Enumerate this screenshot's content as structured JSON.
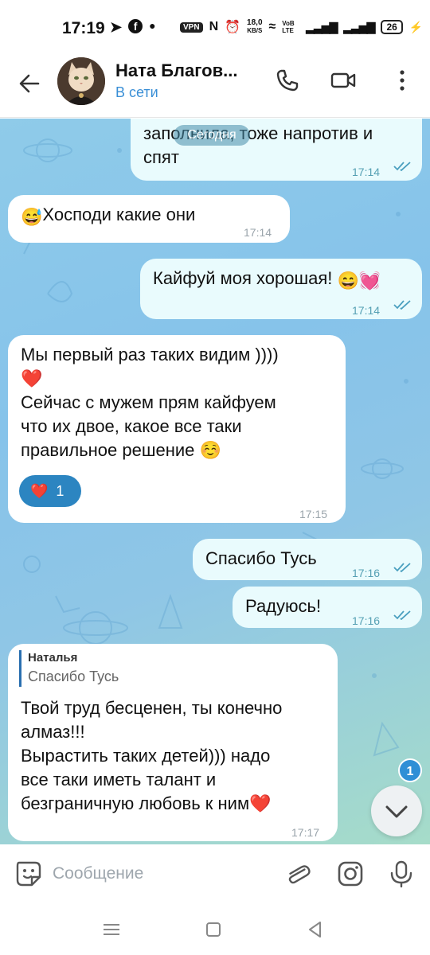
{
  "status_bar": {
    "time": "17:19",
    "vpn_label": "VPN",
    "speed_value": "18,0",
    "speed_unit": "KB/S",
    "volte": "VoB LTE",
    "battery": "26"
  },
  "header": {
    "contact_name": "Ната Благов...",
    "contact_status": "В сети"
  },
  "chat": {
    "date_chip": "Сегодня",
    "messages": [
      {
        "direction": "out",
        "text_lines": [
          "заполнила, тоже напротив и",
          "спят"
        ],
        "time": "17:14",
        "read": true
      },
      {
        "direction": "in",
        "emoji": "😅",
        "text": "Хосподи какие они",
        "time": "17:14"
      },
      {
        "direction": "out",
        "text": "Кайфуй моя хорошая!",
        "emojis": "😄💓",
        "time": "17:14",
        "read": true
      },
      {
        "direction": "in",
        "text_lines": [
          "Мы первый раз таких видим ))))",
          "❤️",
          "Сейчас с мужем прям кайфуем",
          "что их двое, какое все таки",
          "правильное решение ☺️"
        ],
        "reaction": {
          "emoji": "❤️",
          "count": "1"
        },
        "time": "17:15"
      },
      {
        "direction": "out",
        "text": "Спасибо Тусь",
        "time": "17:16",
        "read": true
      },
      {
        "direction": "out",
        "text": "Радуюсь!",
        "time": "17:16",
        "read": true
      },
      {
        "direction": "in",
        "reply": {
          "name": "Наталья",
          "text": "Спасибо Тусь"
        },
        "text_lines": [
          "Твой труд бесценен, ты конечно",
          "алмаз!!!",
          "Вырастить таких детей))) надо",
          "все таки иметь талант и",
          "безграничную любовь к ним❤️"
        ],
        "time": "17:17"
      }
    ],
    "unread_badge": "1"
  },
  "input": {
    "placeholder": "Сообщение"
  },
  "icons": {
    "back": "arrow-left-icon",
    "call": "phone-icon",
    "video": "video-camera-icon",
    "menu": "more-vertical-icon",
    "sticker": "sticker-icon",
    "attach": "paperclip-icon",
    "camera": "instagram-camera-icon",
    "mic": "microphone-icon"
  },
  "colors": {
    "accent": "#2f8fd6",
    "outgoing_bubble": "#e9fbfd",
    "incoming_bubble": "#ffffff",
    "reaction_bg": "#2c85c1"
  }
}
